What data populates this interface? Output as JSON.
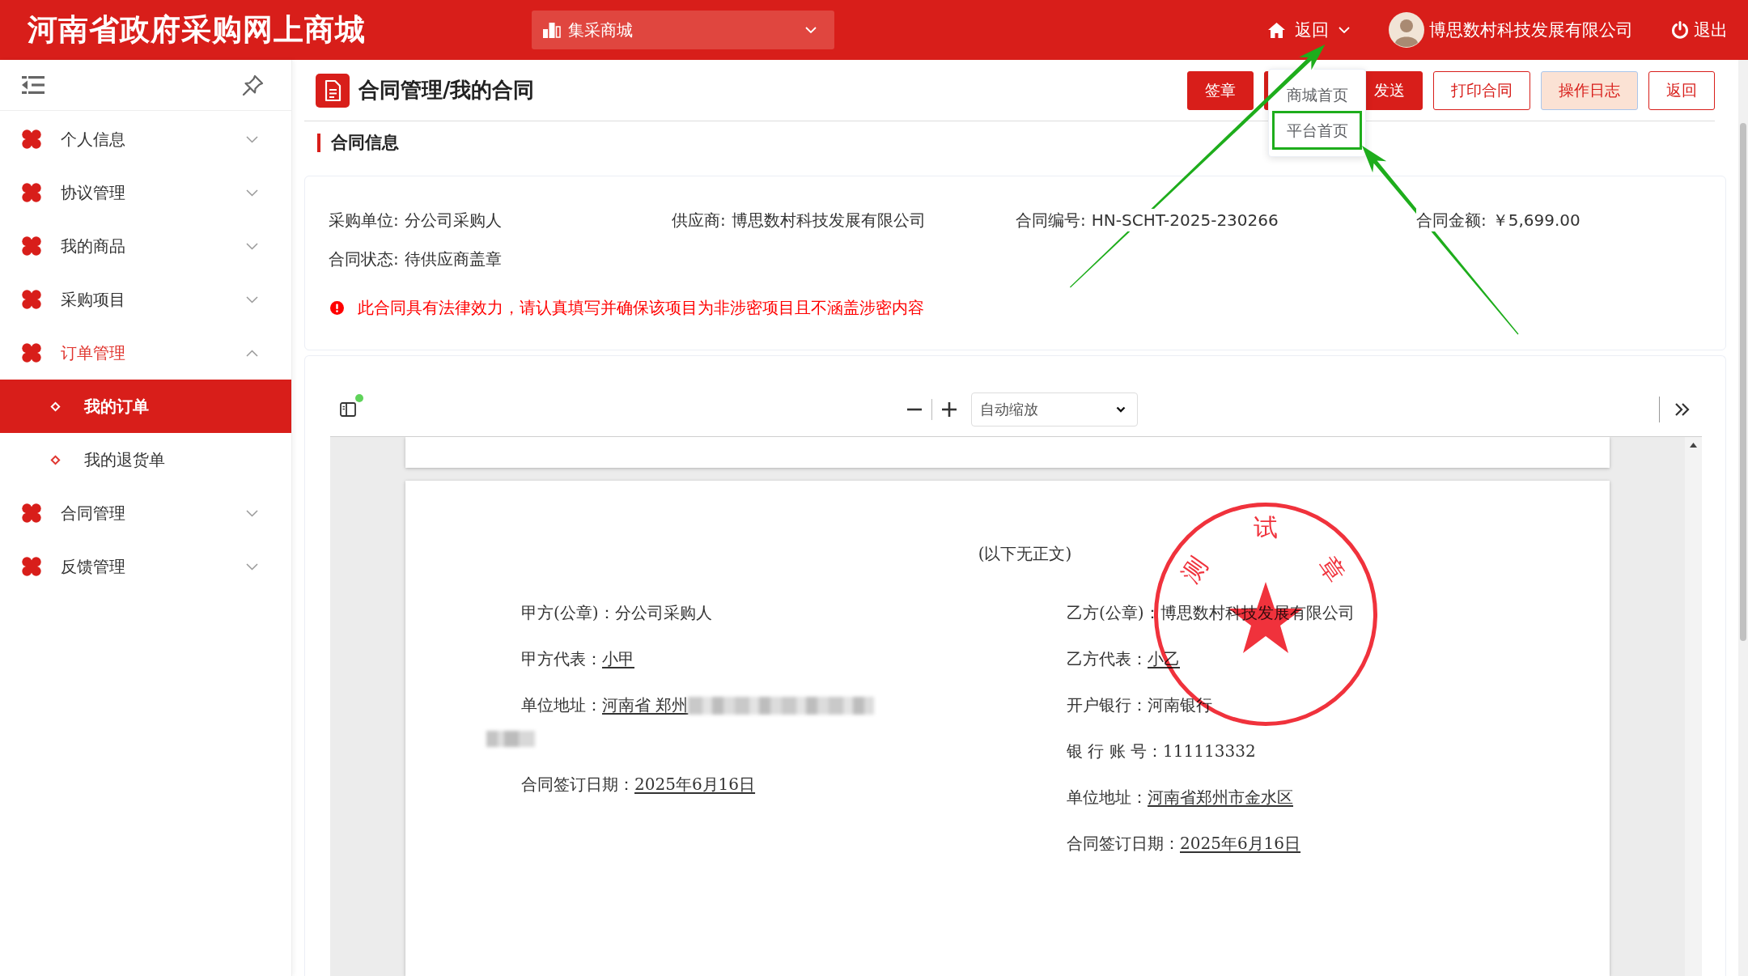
{
  "header": {
    "title": "河南省政府采购网上商城",
    "mall_select": {
      "value": "集采商城"
    },
    "nav": {
      "label": "返回",
      "expanded": true,
      "menu": [
        {
          "label": "商城首页",
          "highlighted": false
        },
        {
          "label": "平台首页",
          "highlighted": true
        }
      ]
    },
    "user": {
      "name": "博思数村科技发展有限公司"
    },
    "logout": {
      "label": "退出"
    }
  },
  "sidebar": {
    "items": [
      {
        "label": "个人信息",
        "selected": false,
        "expanded": false
      },
      {
        "label": "协议管理",
        "selected": false,
        "expanded": false
      },
      {
        "label": "我的商品",
        "selected": false,
        "expanded": false
      },
      {
        "label": "采购项目",
        "selected": false,
        "expanded": false
      },
      {
        "label": "订单管理",
        "selected": true,
        "expanded": true,
        "children": [
          {
            "label": "我的订单",
            "selected": true
          },
          {
            "label": "我的退货单",
            "selected": false
          }
        ]
      },
      {
        "label": "合同管理",
        "selected": false,
        "expanded": false
      },
      {
        "label": "反馈管理",
        "selected": false,
        "expanded": false
      }
    ]
  },
  "page": {
    "title": "合同管理/我的合同",
    "buttons": [
      {
        "label": "签章",
        "kind": "primary"
      },
      {
        "kind": "primary"
      },
      {
        "label": "发送",
        "kind": "primary"
      },
      {
        "label": "打印合同",
        "kind": "outline"
      },
      {
        "label": "操作日志",
        "kind": "soft"
      },
      {
        "label": "返回",
        "kind": "outline"
      }
    ]
  },
  "contract_info": {
    "heading": "合同信息",
    "fields": [
      {
        "label": "采购单位:",
        "value": "分公司采购人"
      },
      {
        "label": "供应商:",
        "value": "博思数村科技发展有限公司"
      },
      {
        "label": "合同编号:",
        "value": "HN-SCHT-2025-230266"
      },
      {
        "label": "合同金额:",
        "value": "￥5,699.00"
      },
      {
        "label": "合同状态:",
        "value": "待供应商盖章"
      }
    ],
    "warning": "此合同具有法律效力，请认真填写并确保该项目为非涉密项目且不涵盖涉密内容"
  },
  "viewer": {
    "sidebar_toggle": {
      "notification": true
    },
    "zoom": {
      "value": "自动缩放"
    },
    "document": {
      "closing": "(以下无正文)",
      "party_a": [
        {
          "label": "甲方(公章)：",
          "value": "分公司采购人",
          "underlined": false,
          "redacted": false
        },
        {
          "label": "甲方代表：",
          "value": "小甲",
          "underlined": true,
          "redacted": false
        },
        {
          "label": "单位地址：",
          "value": "河南省 郑州",
          "underlined": true,
          "redacted": true
        },
        {
          "label": "合同签订日期：",
          "value": "2025年6月16日",
          "underlined": true,
          "redacted": false
        }
      ],
      "party_b": [
        {
          "label": "乙方(公章)：",
          "value": "博思数村科技发展有限公司",
          "underlined": false,
          "redacted": false
        },
        {
          "label": "乙方代表：",
          "value": "小乙",
          "underlined": true,
          "redacted": false
        },
        {
          "label": "开户银行：",
          "value": "河南银行",
          "underlined": false,
          "redacted": false
        },
        {
          "label": "银 行 账 号：",
          "value": "111113332",
          "underlined": false,
          "redacted": false
        },
        {
          "label": "单位地址：",
          "value": "河南省郑州市金水区",
          "underlined": true,
          "redacted": false
        },
        {
          "label": "合同签订日期：",
          "value": "2025年6月16日",
          "underlined": true,
          "redacted": false
        }
      ],
      "stamp": {
        "chars": [
          "测",
          "试",
          "章"
        ]
      }
    }
  },
  "annotations": [
    {
      "kind": "arrow"
    },
    {
      "kind": "arrow"
    }
  ]
}
